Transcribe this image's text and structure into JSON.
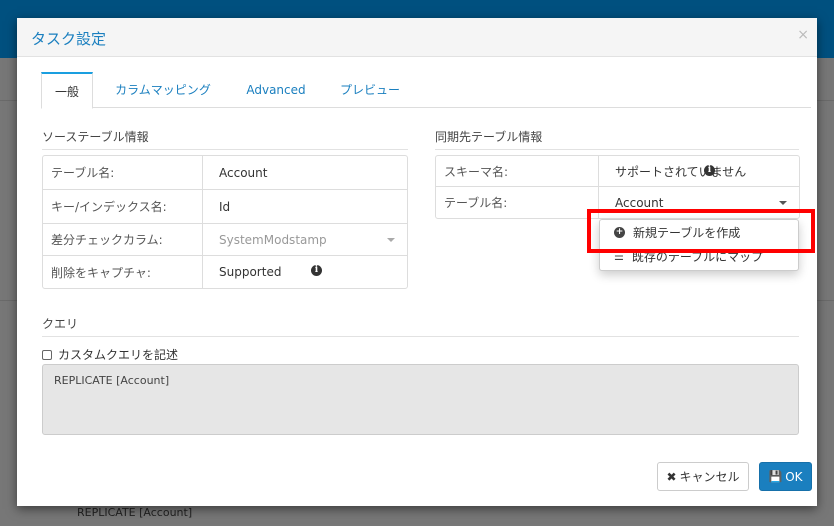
{
  "background": {
    "query_text": "REPLICATE [Account]"
  },
  "modal": {
    "title": "タスク設定",
    "close": "×",
    "tabs": [
      {
        "label": "一般"
      },
      {
        "label": "カラムマッピング"
      },
      {
        "label": "Advanced"
      },
      {
        "label": "プレビュー"
      }
    ],
    "source": {
      "heading": "ソーステーブル情報",
      "rows": [
        {
          "label": "テーブル名:",
          "value": "Account"
        },
        {
          "label": "キー/インデックス名:",
          "value": "Id"
        },
        {
          "label": "差分チェックカラム:",
          "value": "SystemModstamp"
        },
        {
          "label": "削除をキャプチャ:",
          "value": "Supported"
        }
      ]
    },
    "dest": {
      "heading": "同期先テーブル情報",
      "rows": [
        {
          "label": "スキーマ名:",
          "value": "サポートされていません"
        },
        {
          "label": "テーブル名:",
          "value": "Account"
        }
      ]
    },
    "dropdown": {
      "items": [
        {
          "label": "新規テーブルを作成",
          "icon": "plus-circle-icon"
        },
        {
          "label": "既存のテーブルにマップ",
          "icon": "list-icon"
        }
      ]
    },
    "query": {
      "heading": "クエリ",
      "checkbox_label": "カスタムクエリを記述",
      "text": "REPLICATE [Account]"
    },
    "buttons": {
      "cancel": "キャンセル",
      "ok": "OK"
    },
    "colors": {
      "accent": "#1a7fbf",
      "highlight": "#ff0000"
    }
  }
}
